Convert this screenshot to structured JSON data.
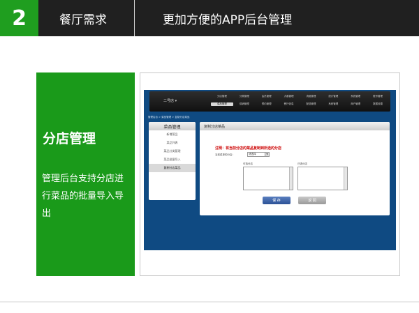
{
  "header": {
    "number": "2",
    "section": "餐厅需求",
    "title": "更加方便的APP后台管理"
  },
  "panel": {
    "title": "分店管理",
    "description": "管理后台支持分店进行菜品的批量导入导出"
  },
  "colors": {
    "header_bg": "#202020",
    "accent_green": "#1a9a1a",
    "app_bg": "#0f4a82",
    "notice_red": "#cc0000"
  },
  "screenshot": {
    "store_selector": "二号店",
    "nav_row1": [
      "分店管理",
      "分类管理",
      "会员管理",
      "大客管理",
      "消费管理",
      "统计管理",
      "系统管理",
      "账号管理"
    ],
    "nav_row2": [
      "菜品管理",
      "促销管理",
      "预约管理",
      "餐厅信息",
      "配送管理",
      "系统管理",
      "商户管理",
      "数据设置"
    ],
    "breadcrumb": "管理后台 > 菜品管理 > 复制分店菜品",
    "sidebar": {
      "title": "菜品管理",
      "items": [
        "新增菜品",
        "菜品列表",
        "菜品分类管理",
        "菜品批量导入",
        "复制分店菜品"
      ]
    },
    "content": {
      "title": "复制分店菜品",
      "notice": "注明：将当前分店的菜品复制到所选的分店",
      "source_label": "当前菜单的分店：",
      "source_value": "请选择",
      "left_box_label": "可选分店",
      "right_box_label": "已选分店",
      "save_label": "保 存",
      "reset_label": "返 回"
    }
  }
}
